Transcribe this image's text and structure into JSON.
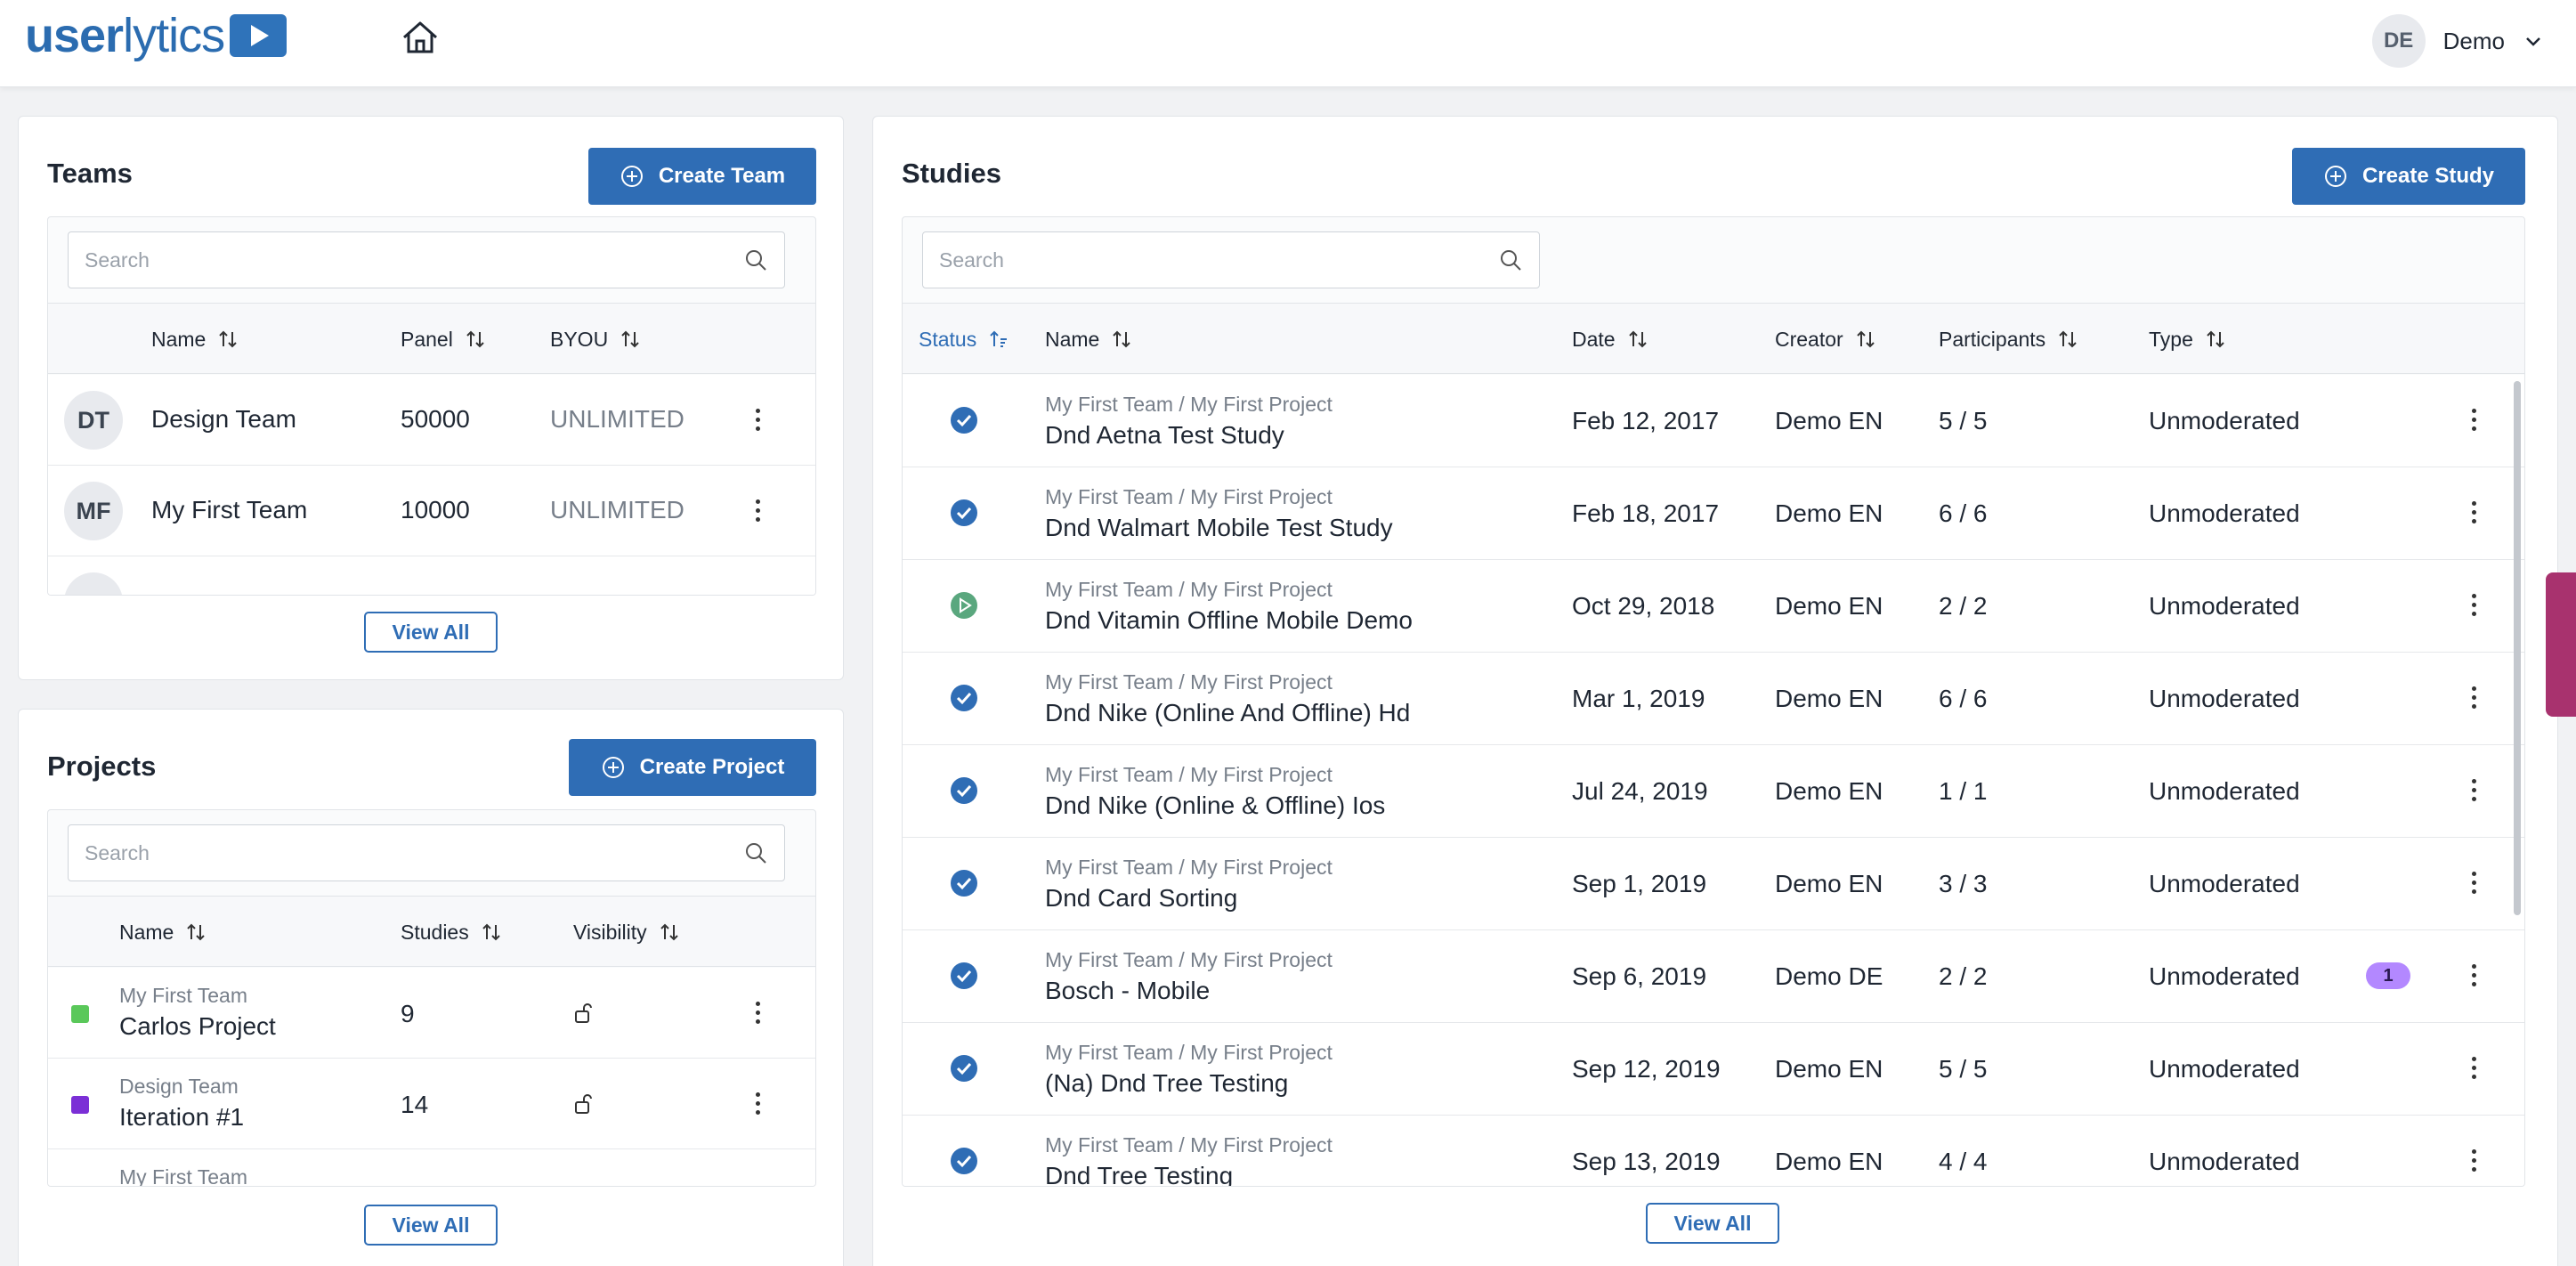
{
  "header": {
    "logo": {
      "part1": "user",
      "part2": "lytics"
    },
    "user": {
      "initials": "DE",
      "name": "Demo"
    }
  },
  "teams": {
    "title": "Teams",
    "create_label": "Create Team",
    "search_placeholder": "Search",
    "columns": {
      "name": "Name",
      "panel": "Panel",
      "byou": "BYOU"
    },
    "rows": [
      {
        "initials": "DT",
        "name": "Design Team",
        "panel": "50000",
        "byou": "UNLIMITED"
      },
      {
        "initials": "MF",
        "name": "My First Team",
        "panel": "10000",
        "byou": "UNLIMITED"
      }
    ],
    "view_all": "View All"
  },
  "projects": {
    "title": "Projects",
    "create_label": "Create Project",
    "search_placeholder": "Search",
    "columns": {
      "name": "Name",
      "studies": "Studies",
      "visibility": "Visibility"
    },
    "rows": [
      {
        "team": "My First Team",
        "name": "Carlos Project",
        "studies": "9",
        "color": "#5ac85a"
      },
      {
        "team": "Design Team",
        "name": "Iteration #1",
        "studies": "14",
        "color": "#7b2fd6"
      },
      {
        "team": "My First Team",
        "name": "",
        "studies": "",
        "color": ""
      }
    ],
    "view_all": "View All"
  },
  "studies": {
    "title": "Studies",
    "create_label": "Create Study",
    "search_placeholder": "Search",
    "columns": {
      "status": "Status",
      "name": "Name",
      "date": "Date",
      "creator": "Creator",
      "participants": "Participants",
      "type": "Type"
    },
    "rows": [
      {
        "status": "completed",
        "path": "My First Team / My First Project",
        "name": "Dnd Aetna Test Study",
        "date": "Feb 12, 2017",
        "creator": "Demo EN",
        "participants": "5 / 5",
        "type": "Unmoderated",
        "badge": ""
      },
      {
        "status": "completed",
        "path": "My First Team / My First Project",
        "name": "Dnd Walmart Mobile Test Study",
        "date": "Feb 18, 2017",
        "creator": "Demo EN",
        "participants": "6 / 6",
        "type": "Unmoderated",
        "badge": ""
      },
      {
        "status": "running",
        "path": "My First Team / My First Project",
        "name": "Dnd Vitamin Offline Mobile Demo",
        "date": "Oct 29, 2018",
        "creator": "Demo EN",
        "participants": "2 / 2",
        "type": "Unmoderated",
        "badge": ""
      },
      {
        "status": "completed",
        "path": "My First Team / My First Project",
        "name": "Dnd Nike (Online And Offline) Hd",
        "date": "Mar 1, 2019",
        "creator": "Demo EN",
        "participants": "6 / 6",
        "type": "Unmoderated",
        "badge": ""
      },
      {
        "status": "completed",
        "path": "My First Team / My First Project",
        "name": "Dnd Nike (Online & Offline) Ios",
        "date": "Jul 24, 2019",
        "creator": "Demo EN",
        "participants": "1 / 1",
        "type": "Unmoderated",
        "badge": ""
      },
      {
        "status": "completed",
        "path": "My First Team / My First Project",
        "name": "Dnd Card Sorting",
        "date": "Sep 1, 2019",
        "creator": "Demo EN",
        "participants": "3 / 3",
        "type": "Unmoderated",
        "badge": ""
      },
      {
        "status": "completed",
        "path": "My First Team / My First Project",
        "name": "Bosch - Mobile",
        "date": "Sep 6, 2019",
        "creator": "Demo DE",
        "participants": "2 / 2",
        "type": "Unmoderated",
        "badge": "1"
      },
      {
        "status": "completed",
        "path": "My First Team / My First Project",
        "name": "(Na) Dnd Tree Testing",
        "date": "Sep 12, 2019",
        "creator": "Demo EN",
        "participants": "5 / 5",
        "type": "Unmoderated",
        "badge": ""
      },
      {
        "status": "completed",
        "path": "My First Team / My First Project",
        "name": "Dnd Tree Testing",
        "date": "Sep 13, 2019",
        "creator": "Demo EN",
        "participants": "4 / 4",
        "type": "Unmoderated",
        "badge": ""
      }
    ],
    "view_all": "View All"
  },
  "colors": {
    "primary": "#2f6db5",
    "success_green": "#5aa77e",
    "badge_purple": "#b388ff",
    "side_tab": "#a8326e"
  },
  "icons": {
    "home": "home-icon",
    "search": "search-icon",
    "sort": "sort-icon",
    "kebab": "more-vertical-icon",
    "lock": "unlock-icon",
    "completed": "check-circle-icon",
    "running": "play-circle-icon",
    "plus": "plus-circle-icon"
  }
}
